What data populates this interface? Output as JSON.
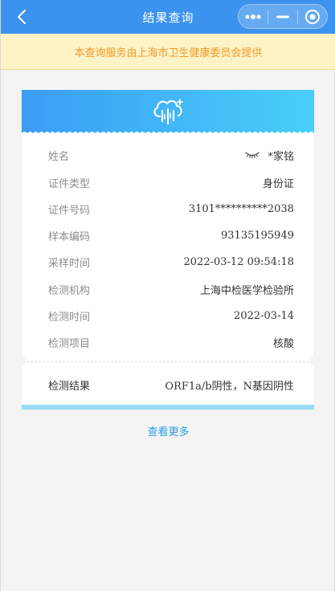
{
  "header": {
    "title": "结果查询"
  },
  "notice": "本查询服务由上海市卫生健康委员会提供",
  "colors": {
    "header": "#3b93ee",
    "accent": "#2a9ee0",
    "notice_text": "#f09a2a"
  },
  "rows": [
    {
      "label": "姓名",
      "value": "*家铭"
    },
    {
      "label": "证件类型",
      "value": "身份证"
    },
    {
      "label": "证件号码",
      "value": "3101**********2038"
    },
    {
      "label": "样本编码",
      "value": "93135195949"
    },
    {
      "label": "采样时间",
      "value": "2022-03-12 09:54:18"
    },
    {
      "label": "检测机构",
      "value": "上海中检医学检验所"
    },
    {
      "label": "检测时间",
      "value": "2022-03-14"
    },
    {
      "label": "检测项目",
      "value": "核酸"
    }
  ],
  "result": {
    "label": "检测结果",
    "value": "ORF1a/b阴性，N基因阴性"
  },
  "more_link": "查看更多",
  "icons": [
    "back-arrow-icon",
    "more-dots-icon",
    "minimize-icon",
    "close-target-icon",
    "cloud-rain-icon",
    "eye-closed-icon"
  ]
}
